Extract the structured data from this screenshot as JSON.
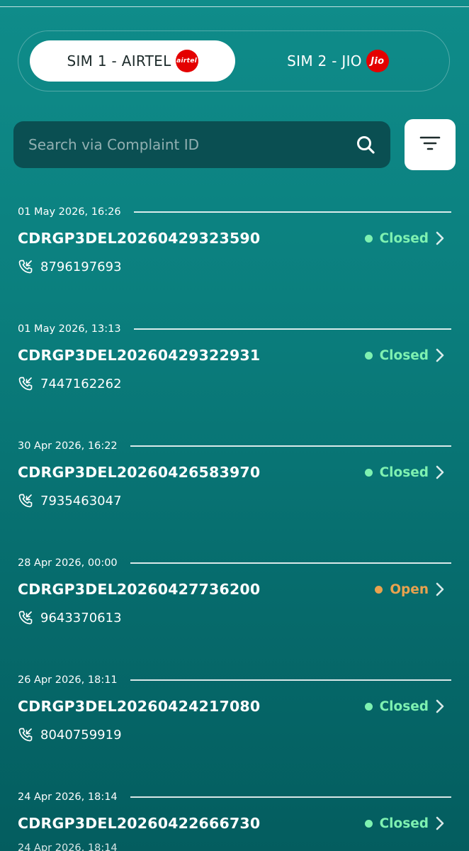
{
  "sim_tabs": [
    {
      "label": "SIM 1 - AIRTEL",
      "logo_text": "airtel",
      "logo_color": "#e40000",
      "active": true
    },
    {
      "label": "SIM 2 - JIO",
      "logo_text": "Jio",
      "logo_color": "#e40000",
      "active": false
    }
  ],
  "search": {
    "placeholder": "Search via Complaint ID",
    "value": "",
    "icon": "search-icon"
  },
  "filter": {
    "icon": "filter-icon"
  },
  "colors": {
    "closed": "#7ef1b1",
    "open": "#e9a24e",
    "background_top": "#0f8c8a",
    "background_bottom": "#045d5f"
  },
  "complaints": [
    {
      "date": "01 May 2026, 16:26",
      "id": "CDRGP3DEL20260429323590",
      "status": "Closed",
      "phone": "8796197693"
    },
    {
      "date": "01 May 2026, 13:13",
      "id": "CDRGP3DEL20260429322931",
      "status": "Closed",
      "phone": "7447162262"
    },
    {
      "date": "30 Apr 2026, 16:22",
      "id": "CDRGP3DEL20260426583970",
      "status": "Closed",
      "phone": "7935463047"
    },
    {
      "date": "28 Apr 2026, 00:00",
      "id": "CDRGP3DEL20260427736200",
      "status": "Open",
      "phone": "9643370613"
    },
    {
      "date": "26 Apr 2026, 18:11",
      "id": "CDRGP3DEL20260424217080",
      "status": "Closed",
      "phone": "8040759919"
    },
    {
      "date": "24 Apr 2026, 18:14",
      "id": "CDRGP3DEL20260422666730",
      "status": "Closed",
      "phone": ""
    }
  ],
  "partial_next_date": "24 Apr 2026, 18:14"
}
